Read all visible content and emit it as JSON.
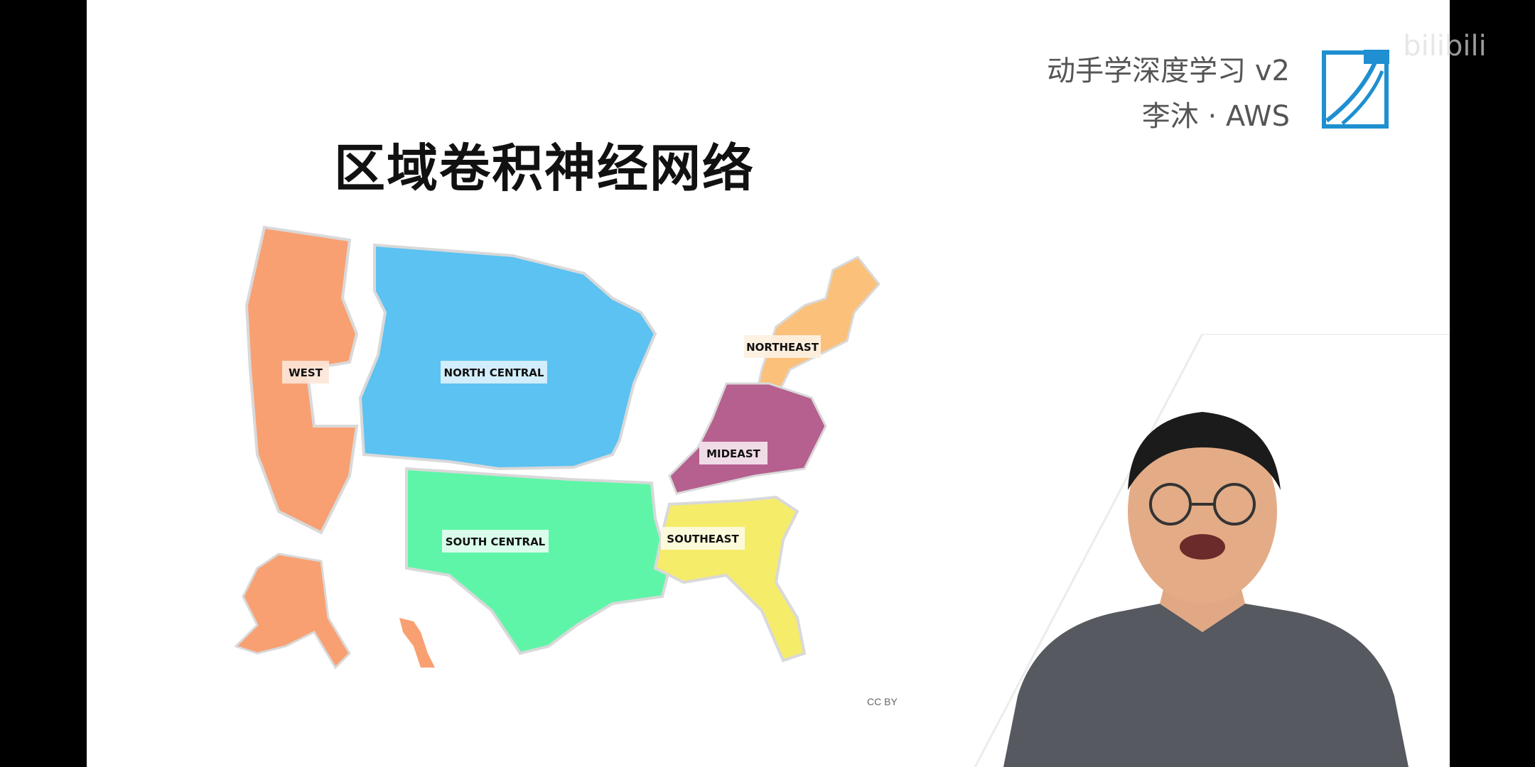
{
  "slide": {
    "title": "区域卷积神经网络",
    "course_line1": "动手学深度学习 v2",
    "course_line2": "李沐 · AWS",
    "credit": "CC BY"
  },
  "map": {
    "regions": [
      {
        "name": "WEST",
        "color": "#f9a072"
      },
      {
        "name": "NORTH CENTRAL",
        "color": "#5bc2f2"
      },
      {
        "name": "NORTHEAST",
        "color": "#fbc07a"
      },
      {
        "name": "MIDEAST",
        "color": "#b5608f"
      },
      {
        "name": "SOUTH CENTRAL",
        "color": "#5ff5a8"
      },
      {
        "name": "SOUTHEAST",
        "color": "#f5ec6a"
      }
    ]
  },
  "branding": {
    "logo_color": "#1e8fd0",
    "watermark": "bilibili"
  }
}
